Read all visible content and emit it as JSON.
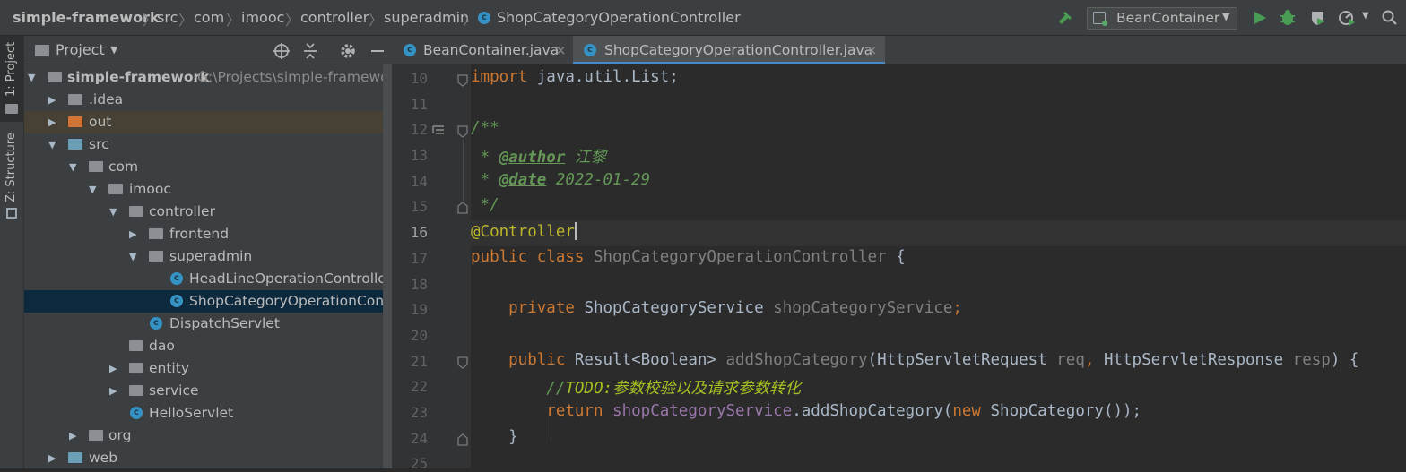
{
  "breadcrumb": {
    "items": [
      "simple-framework",
      "src",
      "com",
      "imooc",
      "controller",
      "superadmin",
      "ShopCategoryOperationController"
    ]
  },
  "toolbar": {
    "run_config": "BeanContainer"
  },
  "left_stripe": {
    "project_tab": "1: Project",
    "structure_tab": "Z: Structure"
  },
  "project_panel": {
    "title": "Project",
    "root_name": "simple-framework",
    "root_path": "G:\\Projects\\simple-framework",
    "tree": [
      {
        "label": ".idea"
      },
      {
        "label": "out"
      },
      {
        "label": "src"
      },
      {
        "label": "com"
      },
      {
        "label": "imooc"
      },
      {
        "label": "controller"
      },
      {
        "label": "frontend"
      },
      {
        "label": "superadmin"
      },
      {
        "label": "HeadLineOperationController"
      },
      {
        "label": "ShopCategoryOperationController"
      },
      {
        "label": "DispatchServlet"
      },
      {
        "label": "dao"
      },
      {
        "label": "entity"
      },
      {
        "label": "service"
      },
      {
        "label": "HelloServlet"
      },
      {
        "label": "org"
      },
      {
        "label": "web"
      }
    ]
  },
  "editor": {
    "tabs": [
      {
        "label": "BeanContainer.java",
        "active": false
      },
      {
        "label": "ShopCategoryOperationController.java",
        "active": true
      }
    ],
    "line_numbers": [
      "10",
      "11",
      "12",
      "13",
      "14",
      "15",
      "16",
      "17",
      "18",
      "19",
      "20",
      "21",
      "22",
      "23",
      "24",
      "25"
    ],
    "current_line": "16",
    "code": {
      "l10_kw": "import",
      "l10_rest": " java.util.List;",
      "l12": "/**",
      "l13_star": " * ",
      "l13_tag": "@author",
      "l13_val": " 江黎",
      "l14_star": " * ",
      "l14_tag": "@date",
      "l14_val": " 2022-01-29",
      "l15": " */",
      "l16": "@Controller",
      "l17_kw": "public class",
      "l17_name": " ShopCategoryOperationController ",
      "l17_brace": "{",
      "l19_kw": "    private",
      "l19_type": " ShopCategoryService ",
      "l19_field": "shopCategoryService",
      "l19_semi": ";",
      "l21_kw": "    public",
      "l21_type": " Result<Boolean> ",
      "l21_method": "addShopCategory",
      "l21_open": "(",
      "l21_t1": "HttpServletRequest ",
      "l21_p1": "req",
      "l21_comma": ", ",
      "l21_t2": "HttpServletResponse ",
      "l21_p2": "resp",
      "l21_close": ") {",
      "l22_slash": "        //",
      "l22_todo": "TODO:参数校验以及请求参数转化",
      "l23_kw": "        return",
      "l23_field": " shopCategoryService",
      "l23_call": ".addShopCategory(",
      "l23_new": "new",
      "l23_rest": " ShopCategory());",
      "l24": "    }"
    }
  }
}
